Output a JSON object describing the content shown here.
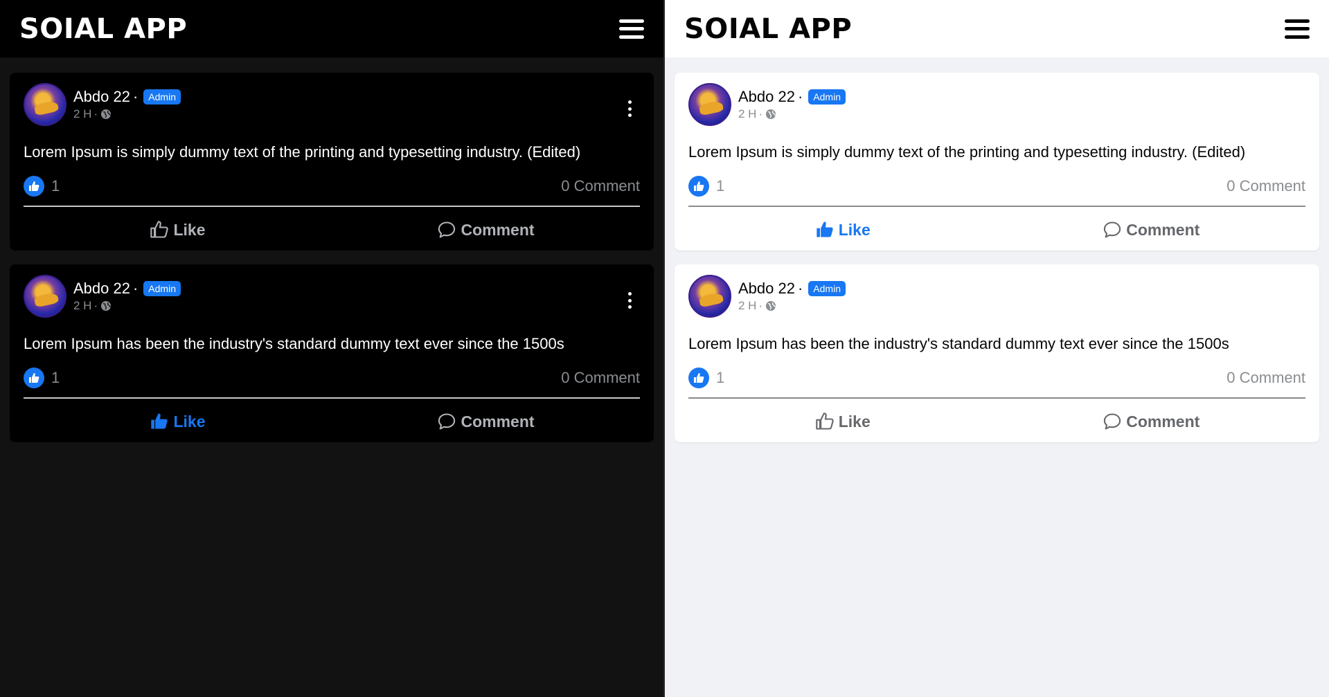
{
  "colors": {
    "accent": "#1877f2",
    "dark_bg": "#121212",
    "light_bg": "#f0f2f5"
  },
  "panels": [
    {
      "theme": "dark",
      "app_title": "SOIAL APP",
      "posts": [
        {
          "author": "Abdo 22",
          "badge": "Admin",
          "time": "2 H",
          "text": "Lorem Ipsum is simply dummy text of the printing and typesetting industry. (Edited)",
          "likes": "1",
          "comments": "0 Comment",
          "like_label": "Like",
          "comment_label": "Comment",
          "liked": false
        },
        {
          "author": "Abdo 22",
          "badge": "Admin",
          "time": "2 H",
          "text": "Lorem Ipsum has been the industry's standard dummy text ever since the 1500s",
          "likes": "1",
          "comments": "0 Comment",
          "like_label": "Like",
          "comment_label": "Comment",
          "liked": true
        }
      ]
    },
    {
      "theme": "light",
      "app_title": "SOIAL APP",
      "posts": [
        {
          "author": "Abdo 22",
          "badge": "Admin",
          "time": "2 H",
          "text": "Lorem Ipsum is simply dummy text of the printing and typesetting industry. (Edited)",
          "likes": "1",
          "comments": "0 Comment",
          "like_label": "Like",
          "comment_label": "Comment",
          "liked": true
        },
        {
          "author": "Abdo 22",
          "badge": "Admin",
          "time": "2 H",
          "text": "Lorem Ipsum has been the industry's standard dummy text ever since the 1500s",
          "likes": "1",
          "comments": "0 Comment",
          "like_label": "Like",
          "comment_label": "Comment",
          "liked": false
        }
      ]
    }
  ]
}
